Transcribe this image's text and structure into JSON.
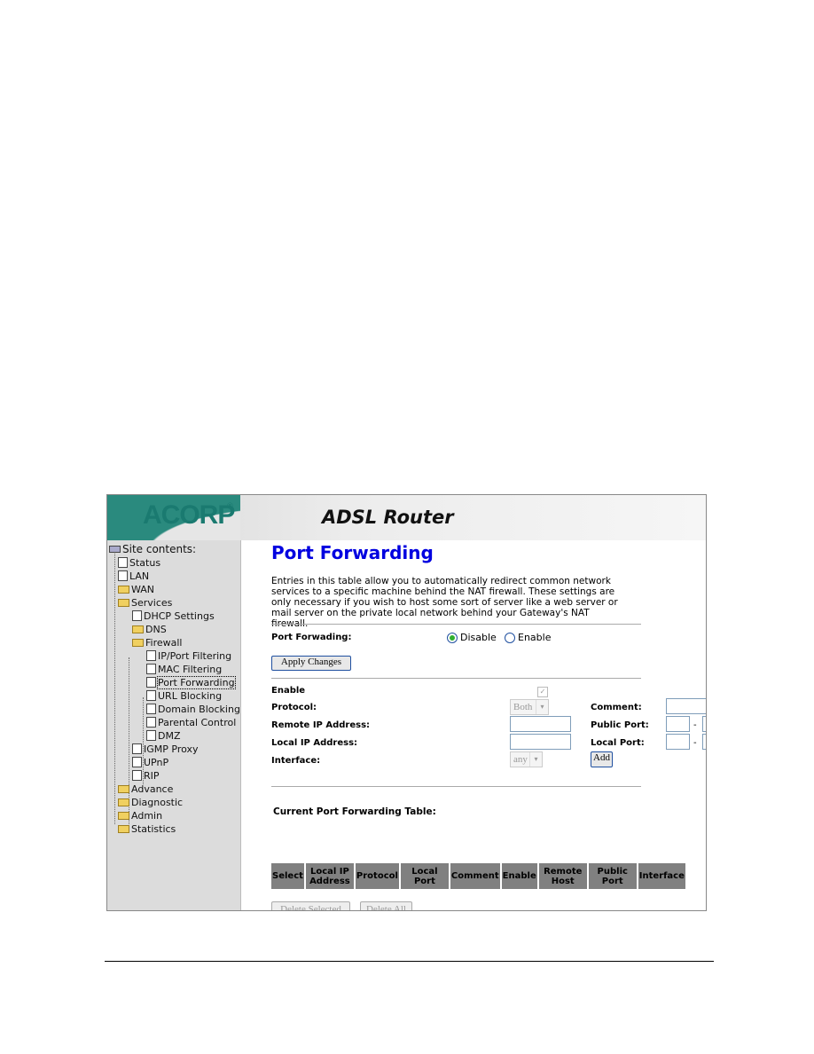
{
  "header": {
    "logo": "ACORP",
    "title": "ADSL Router"
  },
  "sidebar": {
    "root": "Site contents:",
    "items": [
      {
        "label": "Status",
        "icon": "document-icon",
        "level": 1
      },
      {
        "label": "LAN",
        "icon": "document-icon",
        "level": 1
      },
      {
        "label": "WAN",
        "icon": "folder-icon",
        "level": 1
      },
      {
        "label": "Services",
        "icon": "folder-open-icon",
        "level": 1
      },
      {
        "label": "DHCP Settings",
        "icon": "document-icon",
        "level": 2
      },
      {
        "label": "DNS",
        "icon": "folder-icon",
        "level": 2
      },
      {
        "label": "Firewall",
        "icon": "folder-open-icon",
        "level": 2
      },
      {
        "label": "IP/Port Filtering",
        "icon": "document-icon",
        "level": 3
      },
      {
        "label": "MAC Filtering",
        "icon": "document-icon",
        "level": 3
      },
      {
        "label": "Port Forwarding",
        "icon": "document-icon",
        "level": 3,
        "selected": true
      },
      {
        "label": "URL Blocking",
        "icon": "document-icon",
        "level": 3
      },
      {
        "label": "Domain Blocking",
        "icon": "document-icon",
        "level": 3
      },
      {
        "label": "Parental Control",
        "icon": "document-icon",
        "level": 3
      },
      {
        "label": "DMZ",
        "icon": "document-icon",
        "level": 3
      },
      {
        "label": "IGMP Proxy",
        "icon": "document-icon",
        "level": 2
      },
      {
        "label": "UPnP",
        "icon": "document-icon",
        "level": 2
      },
      {
        "label": "RIP",
        "icon": "document-icon",
        "level": 2
      },
      {
        "label": "Advance",
        "icon": "folder-icon",
        "level": 1
      },
      {
        "label": "Diagnostic",
        "icon": "folder-icon",
        "level": 1
      },
      {
        "label": "Admin",
        "icon": "folder-icon",
        "level": 1
      },
      {
        "label": "Statistics",
        "icon": "folder-icon",
        "level": 1
      }
    ]
  },
  "main": {
    "title": "Port Forwarding",
    "description": "Entries in this table allow you to automatically redirect common network services to a specific machine behind the NAT firewall. These settings are only necessary if you wish to host some sort of server like a web server or mail server on the private local network behind your Gateway's NAT firewall.",
    "port_forwarding_label": "Port Forwading:",
    "radio_disable": "Disable",
    "radio_enable": "Enable",
    "radio_selected": "Disable",
    "apply_label": "Apply Changes",
    "enable_label": "Enable",
    "enable_checked": true,
    "protocol_label": "Protocol:",
    "protocol_value": "Both",
    "remote_ip_label": "Remote IP Address:",
    "local_ip_label": "Local IP Address:",
    "interface_label": "Interface:",
    "interface_value": "any",
    "comment_label": "Comment:",
    "public_port_label": "Public Port:",
    "local_port_label": "Local Port:",
    "dash": "-",
    "add_label": "Add",
    "table_title": "Current Port Forwarding Table:",
    "table_headers": [
      "Select",
      "Local IP Address",
      "Protocol",
      "Local Port",
      "Comment",
      "Enable",
      "Remote Host",
      "Public Port",
      "Interface"
    ],
    "delete_selected_label": "Delete Selected",
    "delete_all_label": "Delete All"
  }
}
